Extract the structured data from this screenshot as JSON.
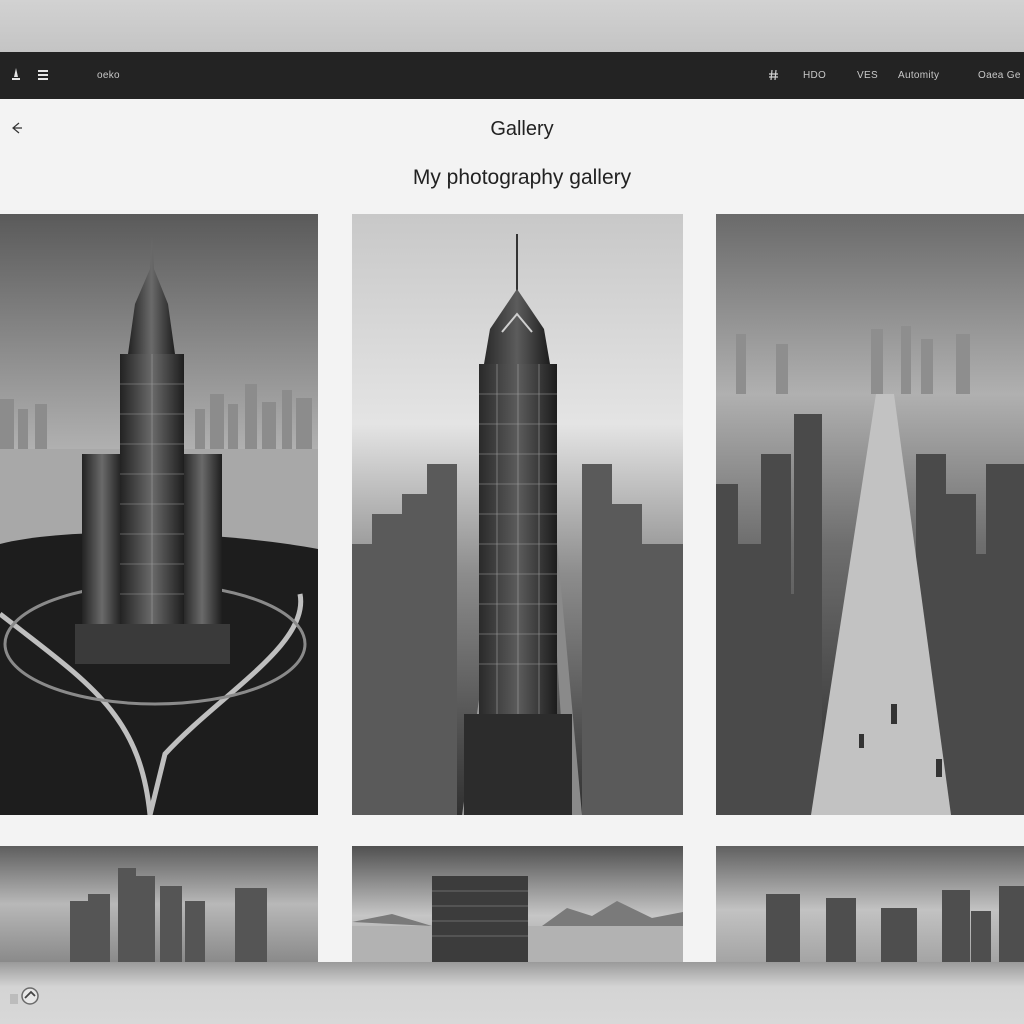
{
  "navbar": {
    "brand": "oeko",
    "links": [
      "HDO",
      "VES",
      "Automity",
      "Oaea Ge"
    ]
  },
  "page": {
    "title": "Gallery",
    "subtitle": "My photography gallery"
  },
  "icons": {
    "menu": "menu-icon",
    "back": "back-arrow-icon",
    "nav_glyph": "hash-icon",
    "dock": "app-icon"
  },
  "colors": {
    "navbar_bg": "#232323",
    "page_bg": "#f3f3f3",
    "text": "#222222"
  }
}
